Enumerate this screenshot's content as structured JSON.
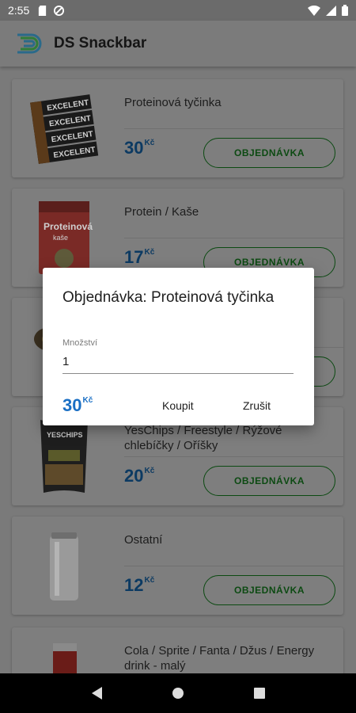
{
  "status_bar": {
    "time": "2:55",
    "left_icons": [
      "sd-card-icon",
      "sync-blocked-icon"
    ],
    "right_icons": [
      "wifi-icon",
      "cellular-signal-icon",
      "battery-icon"
    ]
  },
  "app_bar": {
    "title": "DS Snackbar"
  },
  "products": [
    {
      "name": "Proteinová tyčinka",
      "price": "30",
      "currency": "Kč",
      "button": "OBJEDNÁVKA",
      "image": "protein-bar-icon"
    },
    {
      "name": "Protein / Kaše",
      "price": "17",
      "currency": "Kč",
      "button": "OBJEDNÁVKA",
      "image": "protein-porridge-icon"
    },
    {
      "name": "",
      "price": "",
      "currency": "",
      "button": "",
      "image": "snack-icon"
    },
    {
      "name": "YesChips / Freestyle / Rýžové chlebíčky / Oříšky",
      "price": "20",
      "currency": "Kč",
      "button": "OBJEDNÁVKA",
      "image": "chips-bag-icon"
    },
    {
      "name": "Ostatní",
      "price": "12",
      "currency": "Kč",
      "button": "OBJEDNÁVKA",
      "image": "can-icon"
    },
    {
      "name": "Cola / Sprite / Fanta / Džus / Energy drink - malý",
      "price": "",
      "currency": "",
      "button": "",
      "image": "soda-can-icon"
    }
  ],
  "dialog": {
    "title": "Objednávka: Proteinová tyčinka",
    "field_label": "Množství",
    "field_value": "1",
    "price": "30",
    "currency": "Kč",
    "buy_label": "Koupit",
    "cancel_label": "Zrušit"
  },
  "colors": {
    "accent_blue": "#1a6fc4",
    "accent_green": "#2e9e3a",
    "scrim": "#7a7a7a"
  }
}
